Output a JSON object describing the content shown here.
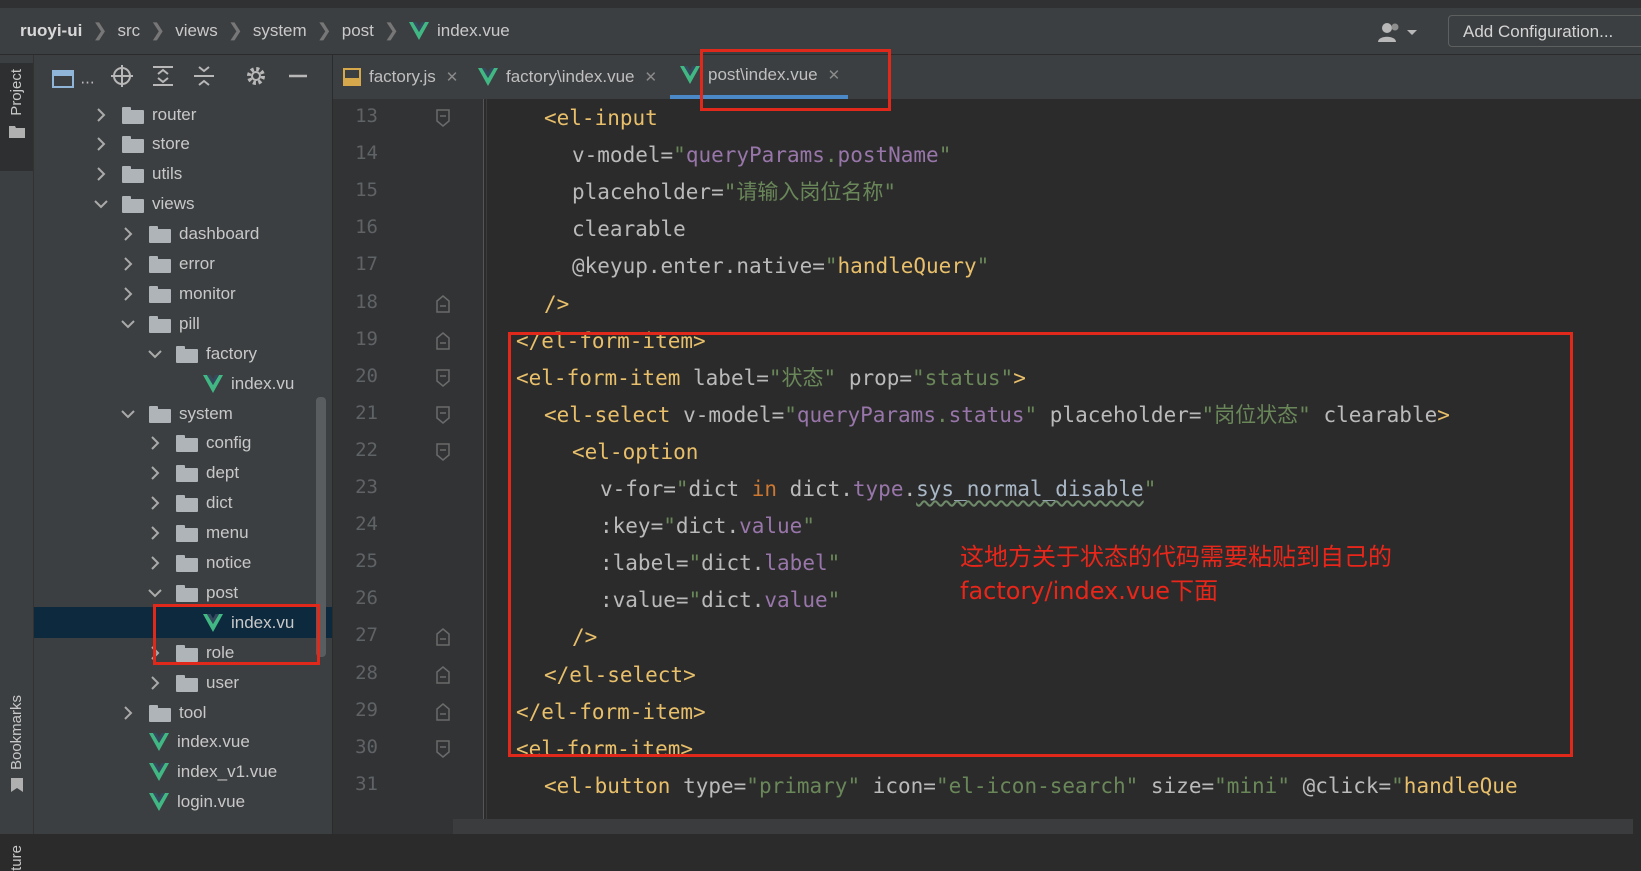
{
  "breadcrumb": {
    "items": [
      "ruoyi-ui",
      "src",
      "views",
      "system",
      "post"
    ],
    "file": "index.vue"
  },
  "toolbar": {
    "add_configuration_label": "Add Configuration...",
    "project_toolbar_label": "..."
  },
  "left_stripe": {
    "project_label": "Project",
    "bookmarks_label": "Bookmarks",
    "structure_label": "ture"
  },
  "tree": {
    "items": [
      {
        "label": "router",
        "kind": "folder",
        "depth": 2,
        "expanded": false
      },
      {
        "label": "store",
        "kind": "folder",
        "depth": 2,
        "expanded": false
      },
      {
        "label": "utils",
        "kind": "folder",
        "depth": 2,
        "expanded": false
      },
      {
        "label": "views",
        "kind": "folder",
        "depth": 2,
        "expanded": true
      },
      {
        "label": "dashboard",
        "kind": "folder",
        "depth": 3,
        "expanded": false
      },
      {
        "label": "error",
        "kind": "folder",
        "depth": 3,
        "expanded": false
      },
      {
        "label": "monitor",
        "kind": "folder",
        "depth": 3,
        "expanded": false
      },
      {
        "label": "pill",
        "kind": "folder",
        "depth": 3,
        "expanded": true
      },
      {
        "label": "factory",
        "kind": "folder",
        "depth": 4,
        "expanded": true
      },
      {
        "label": "index.vu",
        "kind": "vue",
        "depth": 5
      },
      {
        "label": "system",
        "kind": "folder",
        "depth": 3,
        "expanded": true
      },
      {
        "label": "config",
        "kind": "folder",
        "depth": 4,
        "expanded": false
      },
      {
        "label": "dept",
        "kind": "folder",
        "depth": 4,
        "expanded": false
      },
      {
        "label": "dict",
        "kind": "folder",
        "depth": 4,
        "expanded": false
      },
      {
        "label": "menu",
        "kind": "folder",
        "depth": 4,
        "expanded": false
      },
      {
        "label": "notice",
        "kind": "folder",
        "depth": 4,
        "expanded": false
      },
      {
        "label": "post",
        "kind": "folder",
        "depth": 4,
        "expanded": true
      },
      {
        "label": "index.vu",
        "kind": "vue",
        "depth": 5,
        "selected": true
      },
      {
        "label": "role",
        "kind": "folder",
        "depth": 4,
        "expanded": false
      },
      {
        "label": "user",
        "kind": "folder",
        "depth": 4,
        "expanded": false
      },
      {
        "label": "tool",
        "kind": "folder",
        "depth": 3,
        "expanded": false
      },
      {
        "label": "index.vue",
        "kind": "vue",
        "depth": 3
      },
      {
        "label": "index_v1.vue",
        "kind": "vue",
        "depth": 3
      },
      {
        "label": "login.vue",
        "kind": "vue",
        "depth": 3
      }
    ]
  },
  "editor_tabs": [
    {
      "label": "factory.js",
      "icon": "js-file-icon",
      "active": false
    },
    {
      "label": "factory\\index.vue",
      "icon": "vue-file-icon",
      "active": false
    },
    {
      "label": "post\\index.vue",
      "icon": "vue-file-icon",
      "active": true
    }
  ],
  "code_lines": [
    {
      "n": "13",
      "indent": 1,
      "parts": [
        [
          "tag",
          "<el-input"
        ]
      ]
    },
    {
      "n": "14",
      "indent": 2,
      "parts": [
        [
          "attr",
          "v-model="
        ],
        [
          "str",
          "\""
        ],
        [
          "prop",
          "queryParams"
        ],
        [
          "str",
          "."
        ],
        [
          "prop",
          "postName"
        ],
        [
          "str",
          "\""
        ]
      ]
    },
    {
      "n": "15",
      "indent": 2,
      "parts": [
        [
          "attr",
          "placeholder="
        ],
        [
          "str",
          "\"请输入岗位名称\""
        ]
      ]
    },
    {
      "n": "16",
      "indent": 2,
      "parts": [
        [
          "attr",
          "clearable"
        ]
      ]
    },
    {
      "n": "17",
      "indent": 2,
      "parts": [
        [
          "attr",
          "@keyup.enter.native="
        ],
        [
          "str",
          "\""
        ],
        [
          "tag",
          "handleQuery"
        ],
        [
          "str",
          "\""
        ]
      ]
    },
    {
      "n": "18",
      "indent": 1,
      "parts": [
        [
          "tag",
          "/>"
        ]
      ]
    },
    {
      "n": "19",
      "indent": 0,
      "parts": [
        [
          "tag",
          "</el-form-item>"
        ]
      ]
    },
    {
      "n": "20",
      "indent": 0,
      "parts": [
        [
          "tag",
          "<el-form-item "
        ],
        [
          "attr",
          "label="
        ],
        [
          "str",
          "\"状态\" "
        ],
        [
          "attr",
          "prop="
        ],
        [
          "str",
          "\"status\""
        ],
        [
          "tag",
          ">"
        ]
      ]
    },
    {
      "n": "21",
      "indent": 1,
      "parts": [
        [
          "tag",
          "<el-select "
        ],
        [
          "attr",
          "v-model="
        ],
        [
          "str",
          "\""
        ],
        [
          "prop",
          "queryParams"
        ],
        [
          "str",
          "."
        ],
        [
          "prop",
          "status"
        ],
        [
          "str",
          "\" "
        ],
        [
          "attr",
          "placeholder="
        ],
        [
          "str",
          "\"岗位状态\" "
        ],
        [
          "attr",
          "clearable"
        ],
        [
          "tag",
          ">"
        ]
      ]
    },
    {
      "n": "22",
      "indent": 2,
      "parts": [
        [
          "tag",
          "<el-option"
        ]
      ]
    },
    {
      "n": "23",
      "indent": 3,
      "parts": [
        [
          "attr",
          "v-for="
        ],
        [
          "str",
          "\""
        ],
        [
          "attr",
          "dict "
        ],
        [
          "kw",
          "in"
        ],
        [
          "attr",
          " dict."
        ],
        [
          "prop",
          "type"
        ],
        [
          "attr",
          "."
        ],
        [
          "wavy",
          "sys_normal_disable"
        ],
        [
          "str",
          "\""
        ]
      ]
    },
    {
      "n": "24",
      "indent": 3,
      "parts": [
        [
          "attr",
          ":key="
        ],
        [
          "str",
          "\""
        ],
        [
          "attr",
          "dict."
        ],
        [
          "prop",
          "value"
        ],
        [
          "str",
          "\""
        ]
      ]
    },
    {
      "n": "25",
      "indent": 3,
      "parts": [
        [
          "attr",
          ":label="
        ],
        [
          "str",
          "\""
        ],
        [
          "attr",
          "dict."
        ],
        [
          "prop",
          "label"
        ],
        [
          "str",
          "\""
        ]
      ]
    },
    {
      "n": "26",
      "indent": 3,
      "parts": [
        [
          "attr",
          ":value="
        ],
        [
          "str",
          "\""
        ],
        [
          "attr",
          "dict."
        ],
        [
          "prop",
          "value"
        ],
        [
          "str",
          "\""
        ]
      ]
    },
    {
      "n": "27",
      "indent": 2,
      "parts": [
        [
          "tag",
          "/>"
        ]
      ]
    },
    {
      "n": "28",
      "indent": 1,
      "parts": [
        [
          "tag",
          "</el-select>"
        ]
      ]
    },
    {
      "n": "29",
      "indent": 0,
      "parts": [
        [
          "tag",
          "</el-form-item>"
        ]
      ]
    },
    {
      "n": "30",
      "indent": 0,
      "parts": [
        [
          "tag",
          "<el-form-item>"
        ]
      ]
    },
    {
      "n": "31",
      "indent": 1,
      "parts": [
        [
          "tag",
          "<el-button "
        ],
        [
          "attr",
          "type="
        ],
        [
          "str",
          "\"primary\" "
        ],
        [
          "attr",
          "icon="
        ],
        [
          "str",
          "\"el-icon-search\" "
        ],
        [
          "attr",
          "size="
        ],
        [
          "str",
          "\"mini\" "
        ],
        [
          "attr",
          "@click="
        ],
        [
          "str",
          "\""
        ],
        [
          "tag",
          "handleQue"
        ]
      ]
    }
  ],
  "annotation": {
    "line1": "这地方关于状态的代码需要粘贴到自己的",
    "line2": "factory/index.vue下面"
  },
  "colors": {
    "annotation_red": "#e0281b",
    "active_tab_underline": "#4a88c7",
    "vue_green": "#41b883",
    "tag_yellow": "#e8bf6a",
    "string_green": "#6a8759",
    "property_purple": "#9876aa"
  }
}
